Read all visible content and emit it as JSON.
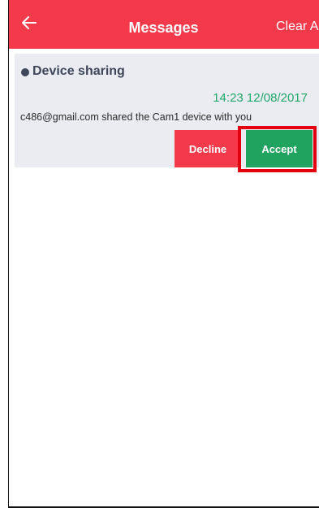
{
  "header": {
    "back_icon": "arrow-left-icon",
    "title": "Messages",
    "clear_all_label": "Clear All"
  },
  "colors": {
    "accent": "#f4394a",
    "accept": "#21a360",
    "timestamp": "#21a86a",
    "card_bg": "#ebebf2",
    "highlight": "#e3000f"
  },
  "notification": {
    "title": "Device sharing",
    "timestamp": "14:23 12/08/2017",
    "message": "c486@gmail.com shared the Cam1 device with you",
    "decline_label": "Decline",
    "accept_label": "Accept"
  }
}
